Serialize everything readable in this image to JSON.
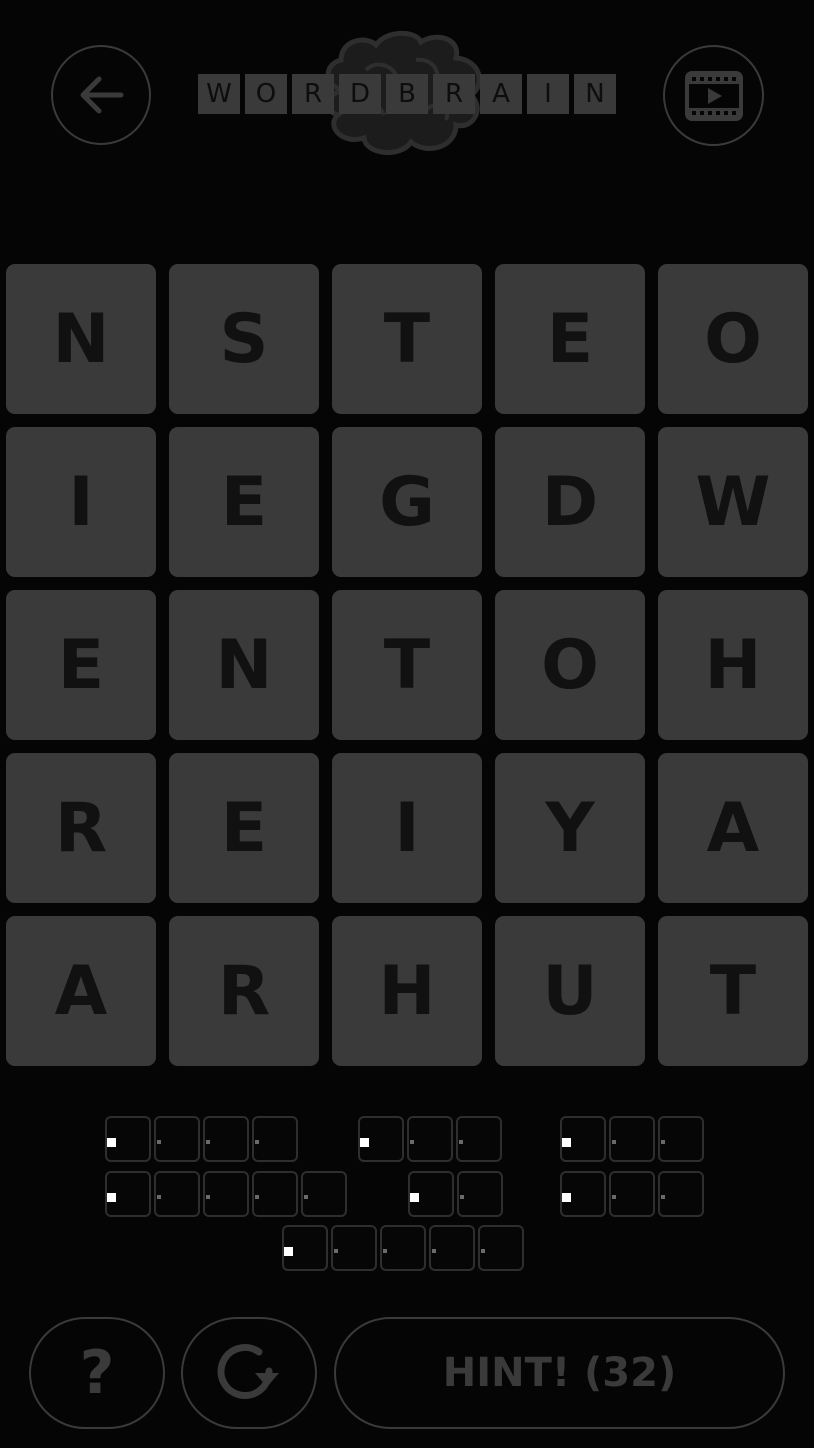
{
  "header": {
    "back_icon": "arrow-left-icon",
    "video_icon": "film-play-icon",
    "logo_letters": [
      "W",
      "O",
      "R",
      "D",
      "B",
      "R",
      "A",
      "I",
      "N"
    ]
  },
  "grid": {
    "rows": [
      [
        "N",
        "S",
        "T",
        "E",
        "O"
      ],
      [
        "I",
        "E",
        "G",
        "D",
        "W"
      ],
      [
        "E",
        "N",
        "T",
        "O",
        "H"
      ],
      [
        "R",
        "E",
        "I",
        "Y",
        "A"
      ],
      [
        "A",
        "R",
        "H",
        "U",
        "T"
      ]
    ]
  },
  "answers": {
    "word_lengths": [
      4,
      3,
      3,
      5,
      2,
      3,
      5
    ]
  },
  "footer": {
    "help_label": "?",
    "reset_icon": "refresh-icon",
    "hint_label": "HINT! (32)"
  },
  "colors": {
    "background": "#050505",
    "tile": "#3a3a3a",
    "letter": "#111111"
  }
}
